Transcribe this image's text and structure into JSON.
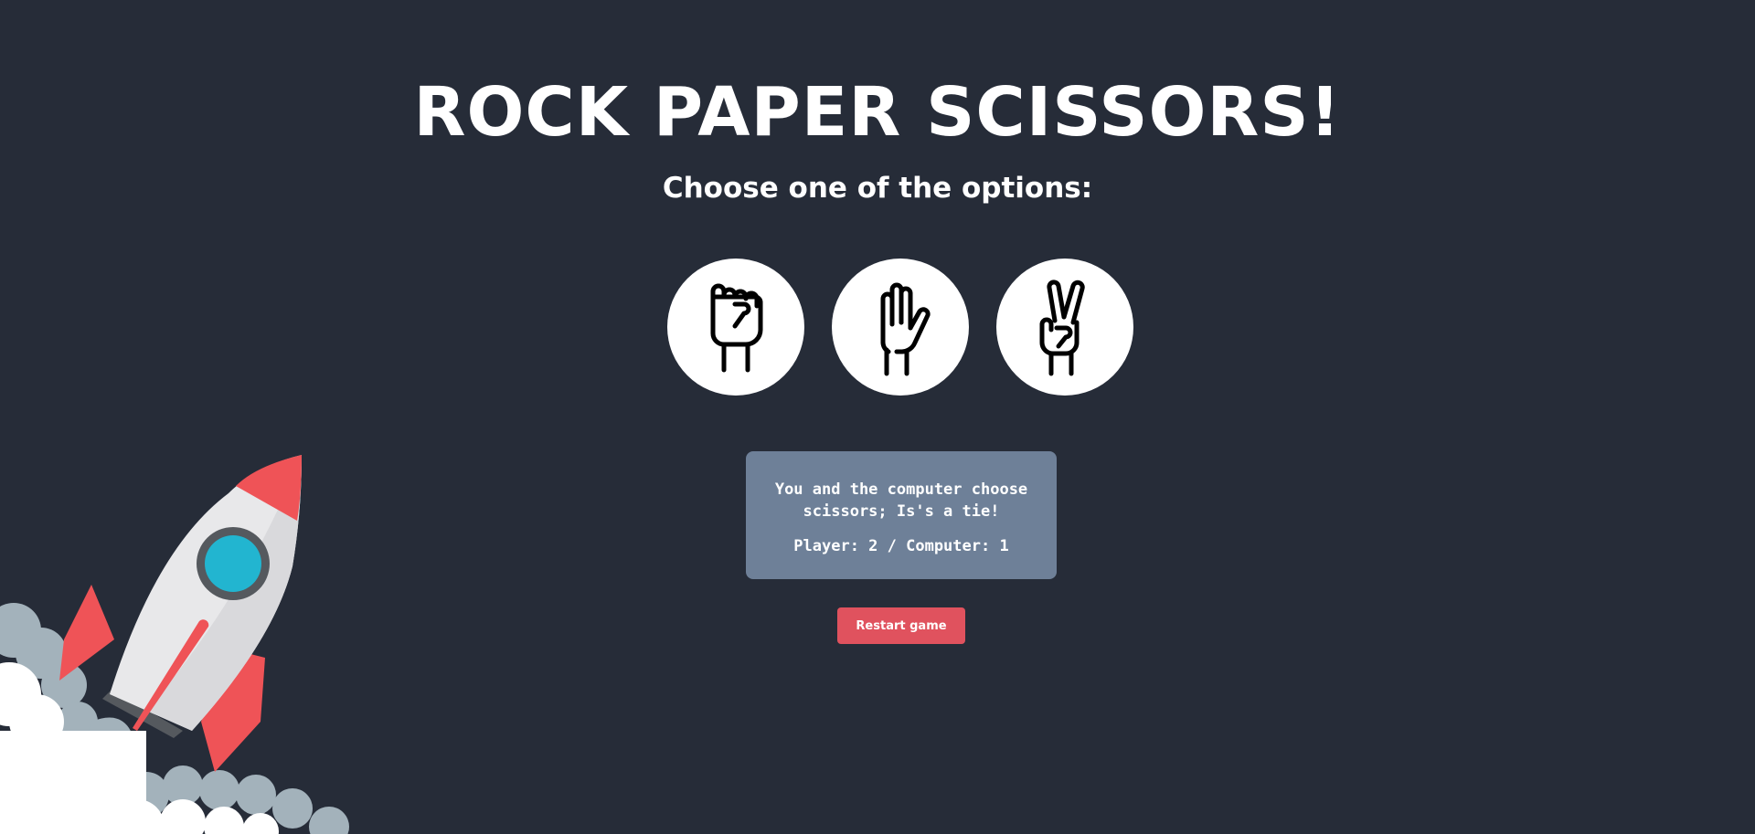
{
  "header": {
    "title": "ROCK PAPER SCISSORS!",
    "subtitle": "Choose one of the options:"
  },
  "options": [
    {
      "name": "rock",
      "icon": "fist-icon"
    },
    {
      "name": "paper",
      "icon": "open-hand-icon"
    },
    {
      "name": "scissors",
      "icon": "peace-hand-icon"
    }
  ],
  "result": {
    "message": "You and the computer choose scissors; Is's a tie!",
    "score": "Player: 2 / Computer: 1"
  },
  "controls": {
    "restart_label": "Restart game"
  },
  "colors": {
    "background": "#262c38",
    "result_box": "#6e8098",
    "restart_button": "#e0525e",
    "rocket_red": "#ef5357",
    "rocket_window": "#22b5d0"
  }
}
